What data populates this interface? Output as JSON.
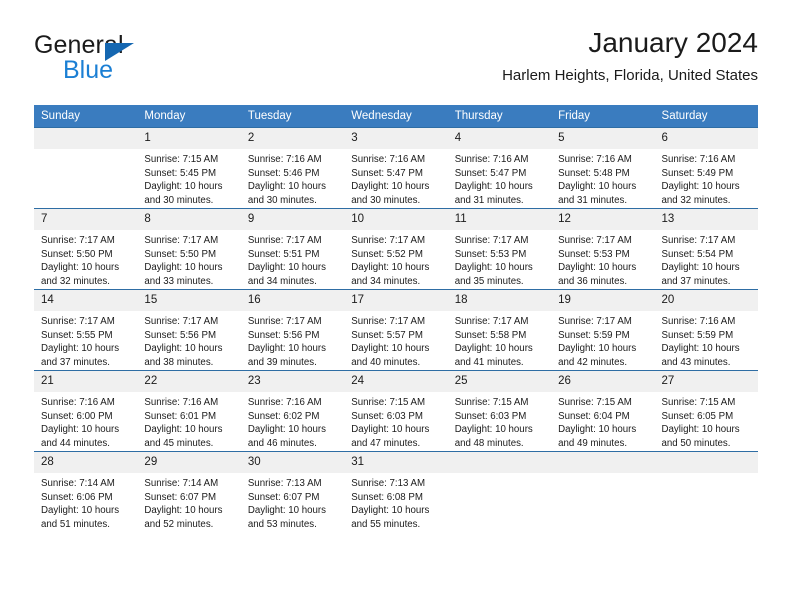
{
  "brand": {
    "name_part1": "General",
    "name_part2": "Blue",
    "triangle_icon": "brand-triangle-icon"
  },
  "header": {
    "title": "January 2024",
    "subtitle": "Harlem Heights, Florida, United States"
  },
  "colors": {
    "header_blue": "#3a7cbf",
    "cell_border_blue": "#2e6da4",
    "daynum_band": "#f0f0f0",
    "brand_blue": "#1b7fd4",
    "brand_triangle": "#1567b1",
    "text": "#1b1b1b"
  },
  "calendar": {
    "weekday_headers": [
      "Sunday",
      "Monday",
      "Tuesday",
      "Wednesday",
      "Thursday",
      "Friday",
      "Saturday"
    ],
    "weeks": [
      [
        {
          "day": "",
          "sunrise": "",
          "sunset": "",
          "daylight_line1": "",
          "daylight_line2": ""
        },
        {
          "day": "1",
          "sunrise": "Sunrise: 7:15 AM",
          "sunset": "Sunset: 5:45 PM",
          "daylight_line1": "Daylight: 10 hours",
          "daylight_line2": "and 30 minutes."
        },
        {
          "day": "2",
          "sunrise": "Sunrise: 7:16 AM",
          "sunset": "Sunset: 5:46 PM",
          "daylight_line1": "Daylight: 10 hours",
          "daylight_line2": "and 30 minutes."
        },
        {
          "day": "3",
          "sunrise": "Sunrise: 7:16 AM",
          "sunset": "Sunset: 5:47 PM",
          "daylight_line1": "Daylight: 10 hours",
          "daylight_line2": "and 30 minutes."
        },
        {
          "day": "4",
          "sunrise": "Sunrise: 7:16 AM",
          "sunset": "Sunset: 5:47 PM",
          "daylight_line1": "Daylight: 10 hours",
          "daylight_line2": "and 31 minutes."
        },
        {
          "day": "5",
          "sunrise": "Sunrise: 7:16 AM",
          "sunset": "Sunset: 5:48 PM",
          "daylight_line1": "Daylight: 10 hours",
          "daylight_line2": "and 31 minutes."
        },
        {
          "day": "6",
          "sunrise": "Sunrise: 7:16 AM",
          "sunset": "Sunset: 5:49 PM",
          "daylight_line1": "Daylight: 10 hours",
          "daylight_line2": "and 32 minutes."
        }
      ],
      [
        {
          "day": "7",
          "sunrise": "Sunrise: 7:17 AM",
          "sunset": "Sunset: 5:50 PM",
          "daylight_line1": "Daylight: 10 hours",
          "daylight_line2": "and 32 minutes."
        },
        {
          "day": "8",
          "sunrise": "Sunrise: 7:17 AM",
          "sunset": "Sunset: 5:50 PM",
          "daylight_line1": "Daylight: 10 hours",
          "daylight_line2": "and 33 minutes."
        },
        {
          "day": "9",
          "sunrise": "Sunrise: 7:17 AM",
          "sunset": "Sunset: 5:51 PM",
          "daylight_line1": "Daylight: 10 hours",
          "daylight_line2": "and 34 minutes."
        },
        {
          "day": "10",
          "sunrise": "Sunrise: 7:17 AM",
          "sunset": "Sunset: 5:52 PM",
          "daylight_line1": "Daylight: 10 hours",
          "daylight_line2": "and 34 minutes."
        },
        {
          "day": "11",
          "sunrise": "Sunrise: 7:17 AM",
          "sunset": "Sunset: 5:53 PM",
          "daylight_line1": "Daylight: 10 hours",
          "daylight_line2": "and 35 minutes."
        },
        {
          "day": "12",
          "sunrise": "Sunrise: 7:17 AM",
          "sunset": "Sunset: 5:53 PM",
          "daylight_line1": "Daylight: 10 hours",
          "daylight_line2": "and 36 minutes."
        },
        {
          "day": "13",
          "sunrise": "Sunrise: 7:17 AM",
          "sunset": "Sunset: 5:54 PM",
          "daylight_line1": "Daylight: 10 hours",
          "daylight_line2": "and 37 minutes."
        }
      ],
      [
        {
          "day": "14",
          "sunrise": "Sunrise: 7:17 AM",
          "sunset": "Sunset: 5:55 PM",
          "daylight_line1": "Daylight: 10 hours",
          "daylight_line2": "and 37 minutes."
        },
        {
          "day": "15",
          "sunrise": "Sunrise: 7:17 AM",
          "sunset": "Sunset: 5:56 PM",
          "daylight_line1": "Daylight: 10 hours",
          "daylight_line2": "and 38 minutes."
        },
        {
          "day": "16",
          "sunrise": "Sunrise: 7:17 AM",
          "sunset": "Sunset: 5:56 PM",
          "daylight_line1": "Daylight: 10 hours",
          "daylight_line2": "and 39 minutes."
        },
        {
          "day": "17",
          "sunrise": "Sunrise: 7:17 AM",
          "sunset": "Sunset: 5:57 PM",
          "daylight_line1": "Daylight: 10 hours",
          "daylight_line2": "and 40 minutes."
        },
        {
          "day": "18",
          "sunrise": "Sunrise: 7:17 AM",
          "sunset": "Sunset: 5:58 PM",
          "daylight_line1": "Daylight: 10 hours",
          "daylight_line2": "and 41 minutes."
        },
        {
          "day": "19",
          "sunrise": "Sunrise: 7:17 AM",
          "sunset": "Sunset: 5:59 PM",
          "daylight_line1": "Daylight: 10 hours",
          "daylight_line2": "and 42 minutes."
        },
        {
          "day": "20",
          "sunrise": "Sunrise: 7:16 AM",
          "sunset": "Sunset: 5:59 PM",
          "daylight_line1": "Daylight: 10 hours",
          "daylight_line2": "and 43 minutes."
        }
      ],
      [
        {
          "day": "21",
          "sunrise": "Sunrise: 7:16 AM",
          "sunset": "Sunset: 6:00 PM",
          "daylight_line1": "Daylight: 10 hours",
          "daylight_line2": "and 44 minutes."
        },
        {
          "day": "22",
          "sunrise": "Sunrise: 7:16 AM",
          "sunset": "Sunset: 6:01 PM",
          "daylight_line1": "Daylight: 10 hours",
          "daylight_line2": "and 45 minutes."
        },
        {
          "day": "23",
          "sunrise": "Sunrise: 7:16 AM",
          "sunset": "Sunset: 6:02 PM",
          "daylight_line1": "Daylight: 10 hours",
          "daylight_line2": "and 46 minutes."
        },
        {
          "day": "24",
          "sunrise": "Sunrise: 7:15 AM",
          "sunset": "Sunset: 6:03 PM",
          "daylight_line1": "Daylight: 10 hours",
          "daylight_line2": "and 47 minutes."
        },
        {
          "day": "25",
          "sunrise": "Sunrise: 7:15 AM",
          "sunset": "Sunset: 6:03 PM",
          "daylight_line1": "Daylight: 10 hours",
          "daylight_line2": "and 48 minutes."
        },
        {
          "day": "26",
          "sunrise": "Sunrise: 7:15 AM",
          "sunset": "Sunset: 6:04 PM",
          "daylight_line1": "Daylight: 10 hours",
          "daylight_line2": "and 49 minutes."
        },
        {
          "day": "27",
          "sunrise": "Sunrise: 7:15 AM",
          "sunset": "Sunset: 6:05 PM",
          "daylight_line1": "Daylight: 10 hours",
          "daylight_line2": "and 50 minutes."
        }
      ],
      [
        {
          "day": "28",
          "sunrise": "Sunrise: 7:14 AM",
          "sunset": "Sunset: 6:06 PM",
          "daylight_line1": "Daylight: 10 hours",
          "daylight_line2": "and 51 minutes."
        },
        {
          "day": "29",
          "sunrise": "Sunrise: 7:14 AM",
          "sunset": "Sunset: 6:07 PM",
          "daylight_line1": "Daylight: 10 hours",
          "daylight_line2": "and 52 minutes."
        },
        {
          "day": "30",
          "sunrise": "Sunrise: 7:13 AM",
          "sunset": "Sunset: 6:07 PM",
          "daylight_line1": "Daylight: 10 hours",
          "daylight_line2": "and 53 minutes."
        },
        {
          "day": "31",
          "sunrise": "Sunrise: 7:13 AM",
          "sunset": "Sunset: 6:08 PM",
          "daylight_line1": "Daylight: 10 hours",
          "daylight_line2": "and 55 minutes."
        },
        {
          "day": "",
          "sunrise": "",
          "sunset": "",
          "daylight_line1": "",
          "daylight_line2": ""
        },
        {
          "day": "",
          "sunrise": "",
          "sunset": "",
          "daylight_line1": "",
          "daylight_line2": ""
        },
        {
          "day": "",
          "sunrise": "",
          "sunset": "",
          "daylight_line1": "",
          "daylight_line2": ""
        }
      ]
    ]
  }
}
